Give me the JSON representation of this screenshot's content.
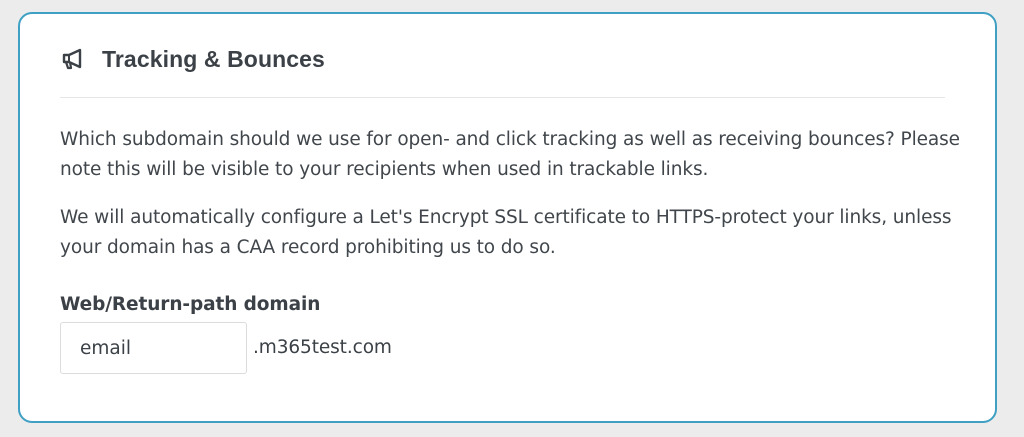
{
  "section": {
    "icon": "megaphone-icon",
    "title": "Tracking & Bounces"
  },
  "description": {
    "paragraph_1": "Which subdomain should we use for open- and click tracking as well as receiving bounces? Please note this will be visible to your recipients when used in trackable links.",
    "paragraph_2": "We will automatically configure a Let's Encrypt SSL certificate to HTTPS-protect your links, unless your domain has a CAA record prohibiting us to do so."
  },
  "domain_field": {
    "label": "Web/Return-path domain",
    "value": "email",
    "suffix": ".m365test.com"
  },
  "colors": {
    "card_border": "#3fa0c4",
    "text": "#3b4146",
    "background": "#ececec"
  }
}
